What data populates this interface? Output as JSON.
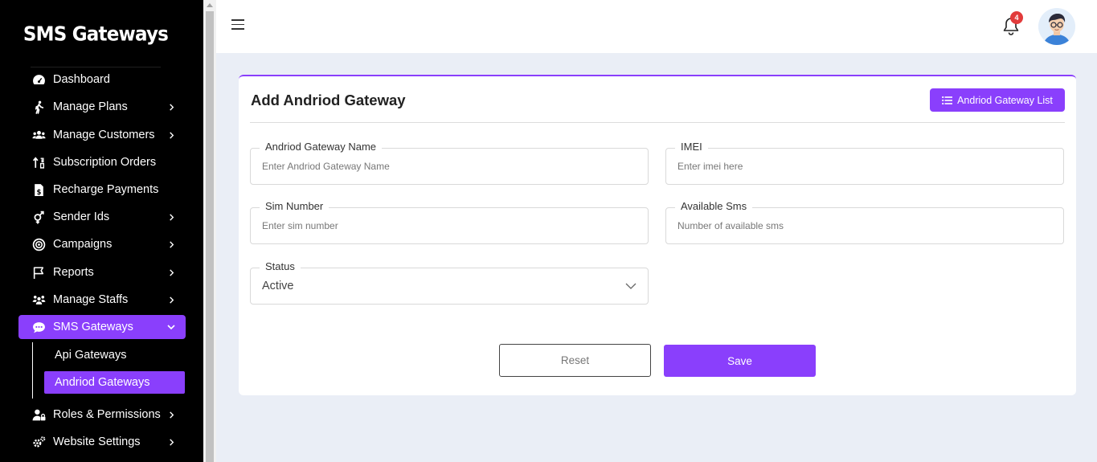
{
  "sidebar": {
    "brand": "SMS Gateways",
    "items": [
      {
        "label": "Dashboard",
        "icon": "gauge-icon",
        "has_chevron": false
      },
      {
        "label": "Manage Plans",
        "icon": "walking-icon",
        "has_chevron": true
      },
      {
        "label": "Manage Customers",
        "icon": "users-icon",
        "has_chevron": true
      },
      {
        "label": "Subscription Orders",
        "icon": "sort-arrows-icon",
        "has_chevron": false
      },
      {
        "label": "Recharge Payments",
        "icon": "invoice-dollar-icon",
        "has_chevron": false
      },
      {
        "label": "Sender Ids",
        "icon": "gender-icon",
        "has_chevron": true
      },
      {
        "label": "Campaigns",
        "icon": "bullseye-icon",
        "has_chevron": true
      },
      {
        "label": "Reports",
        "icon": "flag-icon",
        "has_chevron": true
      },
      {
        "label": "Manage Staffs",
        "icon": "staff-group-icon",
        "has_chevron": true
      },
      {
        "label": "SMS Gateways",
        "icon": "chat-bubble-icon",
        "has_chevron": true,
        "active": true
      },
      {
        "label": "Roles & Permissions",
        "icon": "user-lock-icon",
        "has_chevron": true
      },
      {
        "label": "Website Settings",
        "icon": "cogs-icon",
        "has_chevron": true
      }
    ],
    "sub_items": [
      {
        "label": "Api Gateways"
      },
      {
        "label": "Andriod Gateways",
        "active": true
      }
    ]
  },
  "header": {
    "notification_count": "4"
  },
  "form": {
    "title": "Add Andriod Gateway",
    "list_button": "Andriod Gateway List",
    "fields": {
      "name": {
        "label": "Andriod Gateway Name",
        "placeholder": "Enter Andriod Gateway Name",
        "value": ""
      },
      "imei": {
        "label": "IMEI",
        "placeholder": "Enter imei here",
        "value": ""
      },
      "sim": {
        "label": "Sim Number",
        "placeholder": "Enter sim number",
        "value": ""
      },
      "available": {
        "label": "Available Sms",
        "placeholder": "Number of available sms",
        "value": ""
      },
      "status": {
        "label": "Status",
        "value": "Active"
      }
    },
    "reset_label": "Reset",
    "save_label": "Save"
  },
  "colors": {
    "accent": "#8a3ffc",
    "sidebar_bg": "#000000",
    "page_bg": "#eaeef6",
    "badge": "#e23b3b"
  }
}
